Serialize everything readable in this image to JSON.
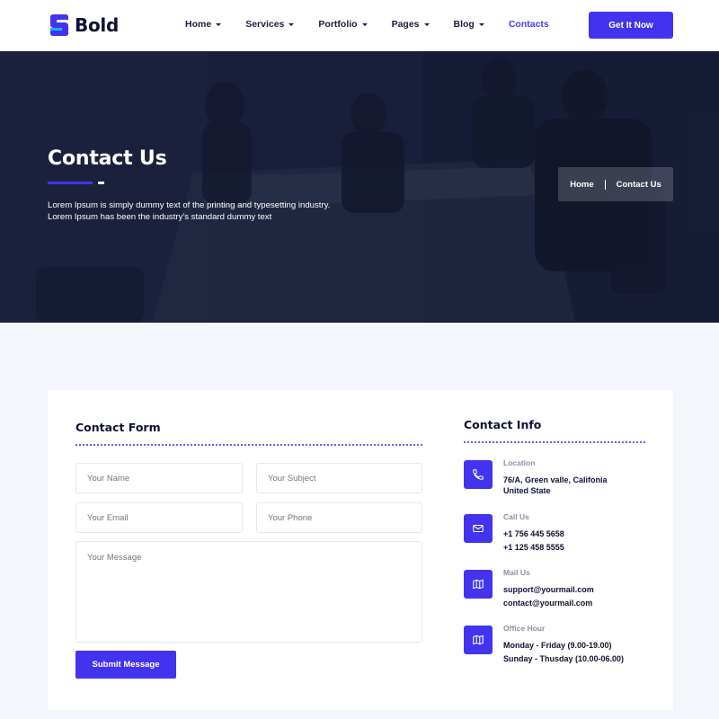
{
  "brand": {
    "name": "Bold",
    "accent": "#4433ee"
  },
  "nav": {
    "items": [
      {
        "label": "Home",
        "dropdown": true
      },
      {
        "label": "Services",
        "dropdown": true
      },
      {
        "label": "Portfolio",
        "dropdown": true
      },
      {
        "label": "Pages",
        "dropdown": true
      },
      {
        "label": "Blog",
        "dropdown": true
      },
      {
        "label": "Contacts",
        "dropdown": false,
        "active": true
      }
    ],
    "cta": "Get It Now"
  },
  "hero": {
    "title": "Contact Us",
    "description_line1": "Lorem Ipsum is simply dummy text of the printing and typesetting industry.",
    "description_line2": "Lorem Ipsum has been the industry's standard dummy text",
    "breadcrumb": {
      "home": "Home",
      "current": "Contact Us"
    }
  },
  "form": {
    "title": "Contact Form",
    "name_placeholder": "Your Name",
    "subject_placeholder": "Your Subject",
    "email_placeholder": "Your Email",
    "phone_placeholder": "Your Phone",
    "message_placeholder": "Your Message",
    "submit": "Submit Message"
  },
  "info": {
    "title": "Contact Info",
    "location": {
      "label": "Location",
      "line1": "76/A, Green valle, Califonia",
      "line2": "United State",
      "icon": "phone-icon"
    },
    "call": {
      "label": "Call Us",
      "line1": "+1 756 445 5658",
      "line2": "+1 125 458 5555",
      "icon": "mail-icon"
    },
    "mail": {
      "label": "Mail Us",
      "line1": "support@yourmail.com",
      "line2": "contact@yourmail.com",
      "icon": "map-icon"
    },
    "hours": {
      "label": "Office Hour",
      "line1": "Monday - Friday (9.00-19.00)",
      "line2": "Sunday - Thusday (10.00-06.00)",
      "icon": "map-icon"
    }
  }
}
